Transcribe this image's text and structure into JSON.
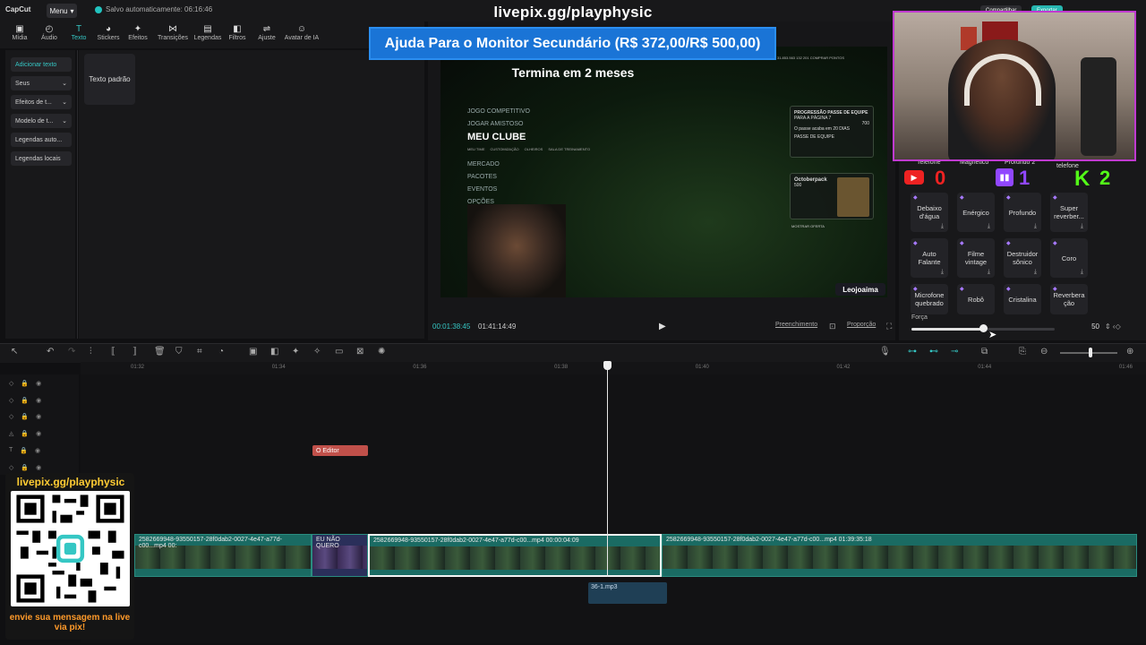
{
  "app": {
    "logo": "CapCut",
    "menu_label": "Menu",
    "autosave": "Salvo automaticamente: 06:16:46",
    "overlay_url": "livepix.gg/playphysic"
  },
  "top_right": {
    "share_label": "Compartilhar",
    "export_label": "Exportar"
  },
  "toolbar": [
    {
      "label": "Mídia",
      "icon": "media-icon"
    },
    {
      "label": "Áudio",
      "icon": "audio-icon"
    },
    {
      "label": "Texto",
      "icon": "text-icon",
      "active": true
    },
    {
      "label": "Stickers",
      "icon": "sticker-icon"
    },
    {
      "label": "Efeitos",
      "icon": "effects-icon"
    },
    {
      "label": "Transições",
      "icon": "transitions-icon"
    },
    {
      "label": "Legendas",
      "icon": "captions-icon"
    },
    {
      "label": "Filtros",
      "icon": "filters-icon"
    },
    {
      "label": "Ajuste",
      "icon": "adjust-icon"
    },
    {
      "label": "Avatar de IA",
      "icon": "ai-avatar-icon"
    }
  ],
  "sidebar": [
    {
      "label": "Adicionar texto"
    },
    {
      "label": "Seus",
      "chevron": true
    },
    {
      "label": "Efeitos de t...",
      "chevron": true
    },
    {
      "label": "Modelo de t...",
      "chevron": true
    },
    {
      "label": "Legendas auto..."
    },
    {
      "label": "Legendas locais"
    }
  ],
  "text_panel": {
    "default_text": "Texto padrão"
  },
  "monitor_banner": "Ajuda Para o Monitor Secundário (R$ 372,00/R$ 500,00)",
  "video": {
    "title": "Termina em 2 meses",
    "menu": [
      "JOGO COMPETITIVO",
      "JOGAR AMISTOSO"
    ],
    "menu_active": "MEU CLUBE",
    "submenu": [
      "MEU TIME",
      "CUSTOMIZAÇÃO",
      "OLHEIROS",
      "SALA DE TREINAMENTO"
    ],
    "menu_more": [
      "MERCADO",
      "PACOTES",
      "EVENTOS",
      "OPÇÕES"
    ],
    "card1_title": "PROGRESSÃO PASSE DE EQUIPE",
    "card1_sub": "PARA A PÁGINA 7",
    "card1_value": "700",
    "card1_note": "O passe acaba em 20 DIAS",
    "pass_label": "PASSE DE EQUIPE",
    "card2_title": "Octoberpack",
    "card2_value": "500",
    "show_offer": "MOSTRAR OFERTA",
    "top_stats": "31.853.563   132   201   COMPRAR PONTOS",
    "streamer_tag": "Leojoaima"
  },
  "player": {
    "current_time": "00:01:38:45",
    "total_time": "01:41:14:49",
    "fill_label": "Preenchimento",
    "ratio_label": "Proporção"
  },
  "socials": {
    "youtube_count": "0",
    "twitch_count": "1",
    "kick_letter": "K",
    "kick_count": "2"
  },
  "effects_top_row": [
    "Telefone",
    "Magnético",
    "Profundo 2",
    "telefone"
  ],
  "effects": [
    [
      "Debaixo d'água",
      "Enérgico",
      "Profundo",
      "Super reverber..."
    ],
    [
      "Auto Falante",
      "Filme vintage",
      "Destruidor sônico",
      "Coro"
    ],
    [
      "Microfone quebrado",
      "Robô",
      "Cristalina",
      "Reverbera ção"
    ]
  ],
  "force": {
    "label": "Força",
    "value": "50",
    "fraction": 0.5
  },
  "ruler_ticks": [
    "01:32",
    "01:34",
    "01:36",
    "01:38",
    "01:40",
    "01:42",
    "01:44",
    "01:46"
  ],
  "timeline": {
    "text_clip": "O Editor",
    "clip_a": "2582669948-93550157-28f0dab2-0027-4e47-a77d-c00...mp4  00:",
    "clip_b_label": "EU NÃO QUERO",
    "clip_c": "2582669948-93550157-28f0dab2-0027-4e47-a77d-c00...mp4   00:00:04:09",
    "clip_d": "2582669948-93550157-28f0dab2-0027-4e47-a77d-c00...mp4   01:39:35:18",
    "audio_clip": "36-1.mp3"
  },
  "qr": {
    "url": "livepix.gg/playphysic",
    "message": "envie sua mensagem na live via pix!"
  }
}
